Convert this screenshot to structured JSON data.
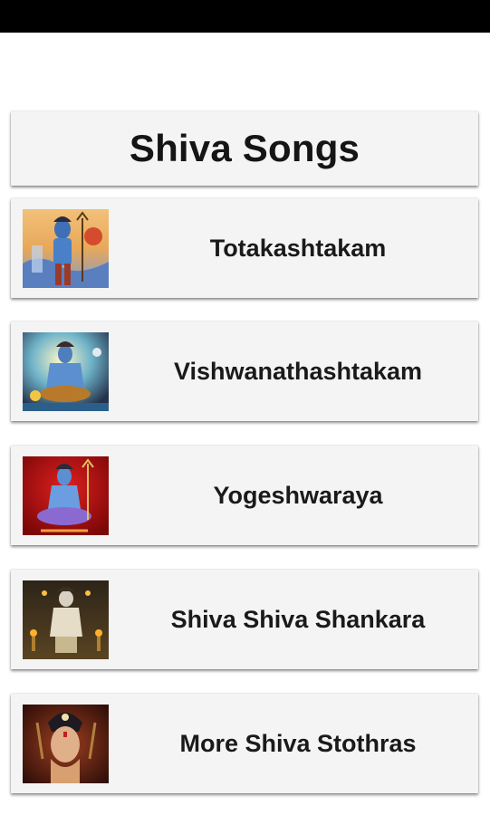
{
  "header": {
    "title": "Shiva Songs"
  },
  "songs": [
    {
      "label": "Totakashtakam",
      "thumbnail": "shiva-standing-image"
    },
    {
      "label": "Vishwanathashtakam",
      "thumbnail": "shiva-meditating-image"
    },
    {
      "label": "Yogeshwaraya",
      "thumbnail": "shiva-red-background-image"
    },
    {
      "label": "Shiva Shiva Shankara",
      "thumbnail": "shiva-lamps-image"
    },
    {
      "label": "More Shiva Stothras",
      "thumbnail": "shiva-face-image"
    }
  ],
  "colors": {
    "status_bar": "#000000",
    "card_background": "#f4f4f4",
    "text": "#1a1a1a"
  }
}
